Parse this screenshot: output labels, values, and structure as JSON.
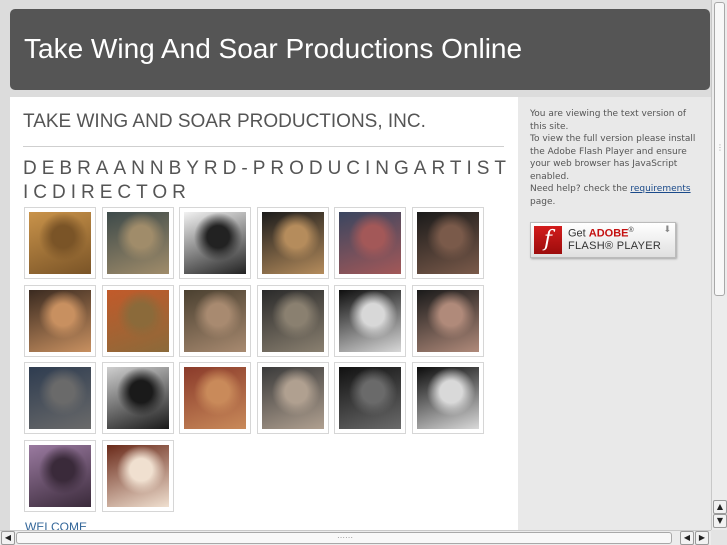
{
  "header": {
    "title": "Take Wing And Soar Productions Online"
  },
  "main": {
    "company": "TAKE WING AND SOAR PRODUCTIONS, INC.",
    "gallery_title": "DEBRAANNBYRD-PRODUCINGARTISTICDIRECTOR",
    "thumbnails": [
      {
        "label": "pyramids photo"
      },
      {
        "label": "Cleopatra poster"
      },
      {
        "label": "Excellence awards poster"
      },
      {
        "label": "2013 Honorees poster"
      },
      {
        "label": "group photo at event"
      },
      {
        "label": "Regong poster"
      },
      {
        "label": "stage performance"
      },
      {
        "label": "costumed performers"
      },
      {
        "label": "stage scene"
      },
      {
        "label": "performer on stage"
      },
      {
        "label": "actor with lantern"
      },
      {
        "label": "two women portrait"
      },
      {
        "label": "cast group photo"
      },
      {
        "label": "singer portrait"
      },
      {
        "label": "stage set with drapes"
      },
      {
        "label": "musicians on stage"
      },
      {
        "label": "performer in dark"
      },
      {
        "label": "seated performer"
      },
      {
        "label": "elder woman portrait"
      },
      {
        "label": "woman in white dress"
      }
    ],
    "welcome_link": "WELCOME"
  },
  "sidebar": {
    "line1": "You are viewing the text version of this site.",
    "line2": "To view the full version please install the Adobe Flash Player and ensure your web browser has JavaScript enabled.",
    "help_prefix": "Need help? check the ",
    "help_link": "requirements",
    "help_suffix": " page.",
    "flash_badge": {
      "get": "Get",
      "adobe": "ADOBE",
      "reg": "®",
      "player": "FLASH® PLAYER",
      "icon": "f"
    }
  },
  "scrollbars": {
    "up": "▲",
    "down": "▼",
    "left": "◀",
    "right": "▶"
  },
  "colors": {
    "header_bg": "#555555",
    "sidebar_bg": "#e9e9e9",
    "thumbs": [
      [
        "#c9934a",
        "#7a5427"
      ],
      [
        "#3d4a4a",
        "#a08c6a"
      ],
      [
        "#f2f2f2",
        "#222222"
      ],
      [
        "#1b1b1b",
        "#b58c5c"
      ],
      [
        "#3a4660",
        "#a35858"
      ],
      [
        "#1a1a1a",
        "#7a5a4a"
      ],
      [
        "#3a2a20",
        "#c89060"
      ],
      [
        "#c25a2a",
        "#8b6a3a"
      ],
      [
        "#4a4030",
        "#a88a70"
      ],
      [
        "#2a2a2a",
        "#8a8070"
      ],
      [
        "#0f0f0f",
        "#d8d8d8"
      ],
      [
        "#1a1a1a",
        "#b08a7a"
      ],
      [
        "#2e3c50",
        "#6a6a6a"
      ],
      [
        "#cfcfcf",
        "#1a1a1a"
      ],
      [
        "#8a3a2a",
        "#c98a5a"
      ],
      [
        "#3a3a3a",
        "#b0a090"
      ],
      [
        "#111111",
        "#6a6a6a"
      ],
      [
        "#0c0c0c",
        "#d9d9d9"
      ],
      [
        "#9a7aa0",
        "#3a2a3a"
      ],
      [
        "#6a2a1a",
        "#f0e0d0"
      ]
    ]
  }
}
